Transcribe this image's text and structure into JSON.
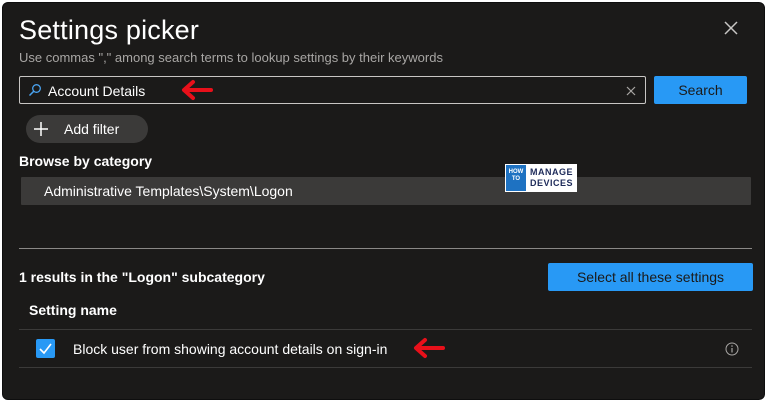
{
  "dialog": {
    "title": "Settings picker",
    "subtitle": "Use commas \",\" among search terms to lookup settings by their keywords"
  },
  "search": {
    "value": "Account Details",
    "button_label": "Search"
  },
  "filter": {
    "add_label": "Add filter"
  },
  "browse": {
    "title": "Browse by category",
    "category": "Administrative Templates\\System\\Logon"
  },
  "watermark": {
    "left": "HOW TO",
    "right_top": "MANAGE",
    "right_bottom": "DEVICES"
  },
  "results": {
    "summary": "1 results in the \"Logon\" subcategory",
    "select_all_label": "Select all these settings",
    "column_header": "Setting name",
    "rows": [
      {
        "label": "Block user from showing account details on sign-in",
        "checked": true
      }
    ]
  },
  "colors": {
    "panel_bg": "#1b1a19",
    "accent": "#2899f5",
    "annotation_arrow": "#e8101a"
  }
}
